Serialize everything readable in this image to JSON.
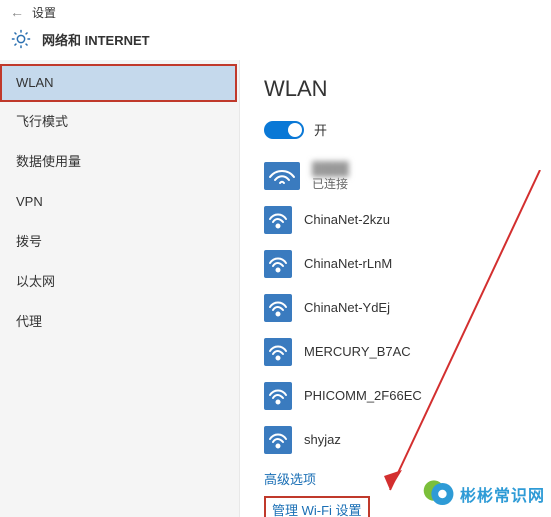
{
  "titlebar": {
    "back": "←",
    "label": "设置"
  },
  "header": {
    "title": "网络和 INTERNET"
  },
  "sidebar": {
    "items": [
      {
        "label": "WLAN",
        "selected": true
      },
      {
        "label": "飞行模式"
      },
      {
        "label": "数据使用量"
      },
      {
        "label": "VPN"
      },
      {
        "label": "拨号"
      },
      {
        "label": "以太网"
      },
      {
        "label": "代理"
      }
    ]
  },
  "main": {
    "title": "WLAN",
    "toggle": {
      "on": true,
      "label": "开"
    },
    "connected": {
      "name": "████",
      "status": "已连接"
    },
    "networks": [
      {
        "name": "ChinaNet-2kzu"
      },
      {
        "name": "ChinaNet-rLnM"
      },
      {
        "name": "ChinaNet-YdEj"
      },
      {
        "name": "MERCURY_B7AC"
      },
      {
        "name": "PHICOMM_2F66EC"
      },
      {
        "name": "shyjaz"
      }
    ],
    "link_advanced": "高级选项",
    "link_manage": "管理 Wi-Fi 设置"
  },
  "watermark": {
    "text": "彬彬常识网"
  }
}
